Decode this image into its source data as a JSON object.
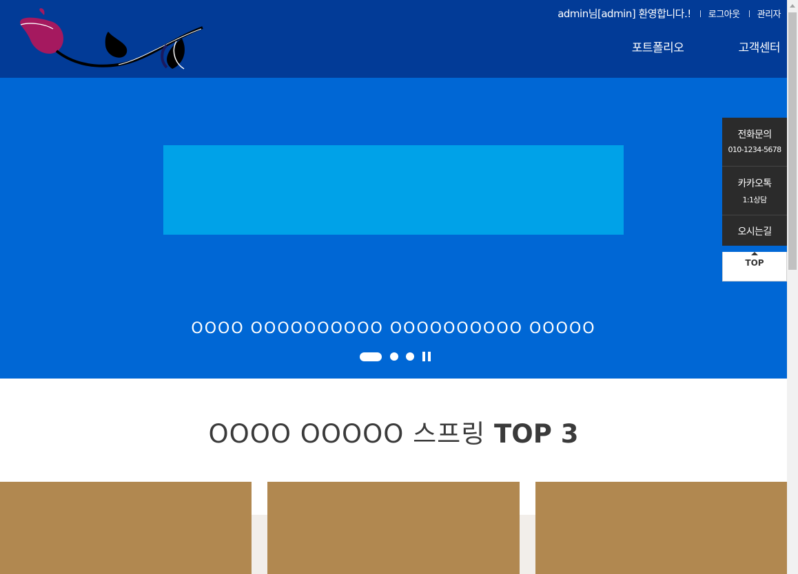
{
  "header": {
    "welcome": "admin님[admin] 환영합니다.!",
    "logout": "로그아웃",
    "admin": "관리자",
    "nav": [
      {
        "label": "포트폴리오"
      },
      {
        "label": "고객센터"
      }
    ]
  },
  "hero": {
    "caption": "OOOO OOOOOOOOOO OOOOOOOOOO OOOOO",
    "slide_count": 3,
    "active_slide": 1
  },
  "quick_menu": {
    "tel_title": "전화문의",
    "tel_number": "010-1234-5678",
    "kakao_title": "카카오톡",
    "kakao_sub": "1:1상담",
    "map_title": "오시는길",
    "top_label": "TOP"
  },
  "section": {
    "title_prefix": "OOOO OOOOO 스프링",
    "title_bold": "TOP 3"
  },
  "colors": {
    "header_bg": "#023b97",
    "hero_bg": "#0067d5",
    "banner": "#00a2e8",
    "card": "#b18850",
    "quick_bg": "#2b2b2b"
  }
}
